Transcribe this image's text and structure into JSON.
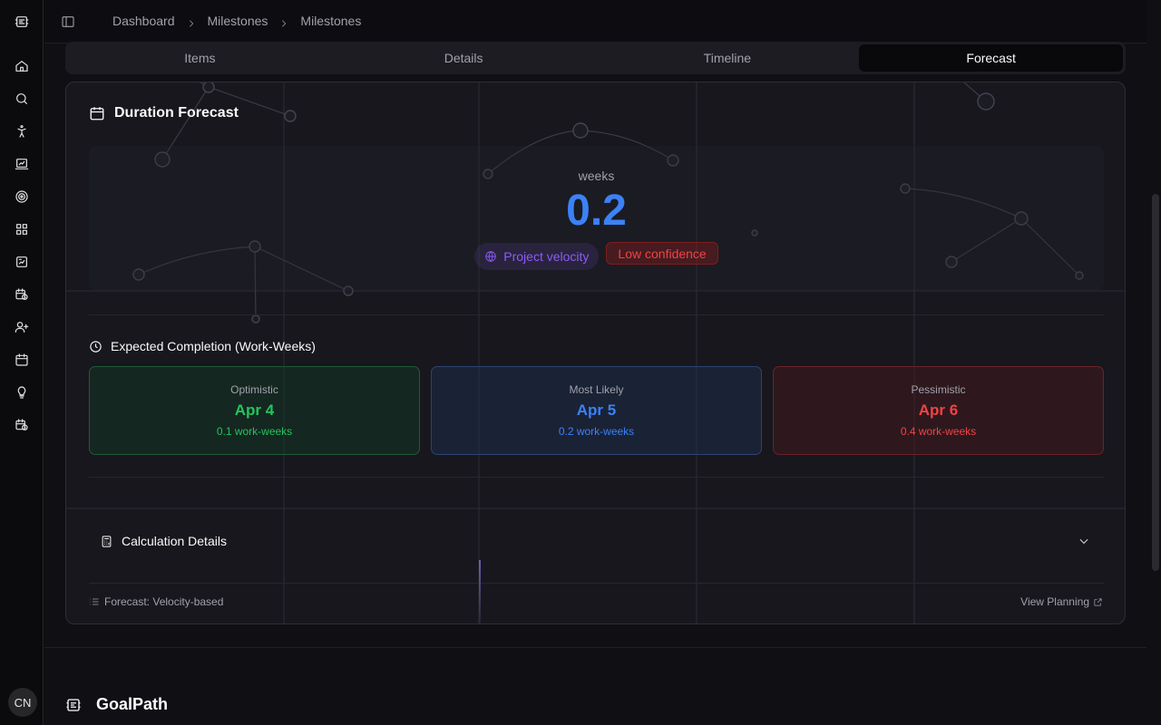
{
  "sidebar": {
    "icons": [
      "logo-icon",
      "home-icon",
      "search-icon",
      "accessibility-icon",
      "chart-icon",
      "target-icon",
      "grid-icon",
      "report-icon",
      "calendar-clock-icon",
      "user-plus-icon",
      "calendar-icon",
      "lightbulb-icon",
      "calendar-clock-icon"
    ],
    "avatar_initials": "CN"
  },
  "breadcrumb": [
    "Dashboard",
    "Milestones",
    "Milestones"
  ],
  "tabs": [
    {
      "label": "Items",
      "active": false
    },
    {
      "label": "Details",
      "active": false
    },
    {
      "label": "Timeline",
      "active": false
    },
    {
      "label": "Forecast",
      "active": true
    }
  ],
  "forecast": {
    "title": "Duration Forecast",
    "unit": "weeks",
    "value": "0.2",
    "source_badge": "Project velocity",
    "confidence_badge": "Low confidence",
    "completion_title": "Expected Completion (Work-Weeks)",
    "estimates": {
      "optimistic": {
        "label": "Optimistic",
        "date": "Apr 4",
        "weeks": "0.1 work-weeks"
      },
      "likely": {
        "label": "Most Likely",
        "date": "Apr 5",
        "weeks": "0.2 work-weeks"
      },
      "pessimistic": {
        "label": "Pessimistic",
        "date": "Apr 6",
        "weeks": "0.4 work-weeks"
      }
    },
    "calc_title": "Calculation Details",
    "footer_left": "Forecast: Velocity-based",
    "footer_right": "View Planning"
  },
  "brand": "GoalPath",
  "colors": {
    "accent_blue": "#3b82f6",
    "success_green": "#22c55e",
    "danger_red": "#ef4444",
    "velocity_purple": "#8b5cf6"
  }
}
